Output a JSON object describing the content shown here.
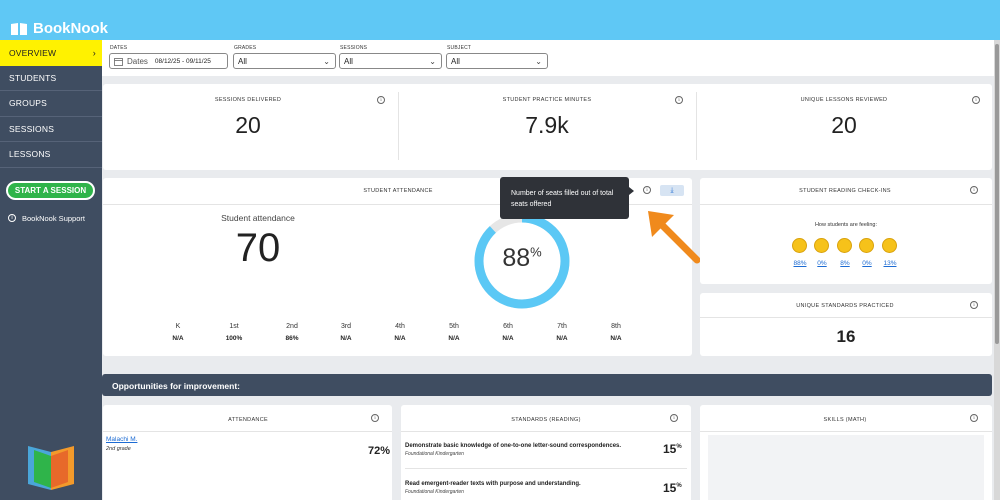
{
  "app": {
    "name": "BookNook"
  },
  "sidebar": {
    "items": [
      {
        "label": "OVERVIEW"
      },
      {
        "label": "STUDENTS"
      },
      {
        "label": "GROUPS"
      },
      {
        "label": "SESSIONS"
      },
      {
        "label": "LESSONS"
      }
    ],
    "start_label": "START A SESSION",
    "support_label": "BookNook Support"
  },
  "filters": {
    "dates_label": "DATES",
    "dates_placeholder": "Dates",
    "dates_value": "08/12/25 - 09/11/25",
    "grades_label": "GRADES",
    "grades_value": "All",
    "sessions_label": "SESSIONS",
    "sessions_value": "All",
    "subject_label": "SUBJECT",
    "subject_value": "All"
  },
  "stats": [
    {
      "title": "SESSIONS DELIVERED",
      "value": "20"
    },
    {
      "title": "STUDENT PRACTICE MINUTES",
      "value": "7.9k"
    },
    {
      "title": "UNIQUE LESSONS REVIEWED",
      "value": "20"
    }
  ],
  "attendance": {
    "title": "STUDENT ATTENDANCE",
    "label": "Student attendance",
    "value": "70",
    "percent": 0.88,
    "percent_num": "88",
    "percent_sign": "%",
    "tooltip": "Number of seats filled out of total seats offered",
    "grades": [
      {
        "grade": "K",
        "value": "N/A"
      },
      {
        "grade": "1st",
        "value": "100%"
      },
      {
        "grade": "2nd",
        "value": "86%"
      },
      {
        "grade": "3rd",
        "value": "N/A"
      },
      {
        "grade": "4th",
        "value": "N/A"
      },
      {
        "grade": "5th",
        "value": "N/A"
      },
      {
        "grade": "6th",
        "value": "N/A"
      },
      {
        "grade": "7th",
        "value": "N/A"
      },
      {
        "grade": "8th",
        "value": "N/A"
      }
    ]
  },
  "checkins": {
    "title": "STUDENT READING CHECK-INS",
    "subtitle": "How students are feeling:",
    "values": [
      "88%",
      "0%",
      "8%",
      "0%",
      "13%"
    ]
  },
  "standards": {
    "title": "UNIQUE STANDARDS PRACTICED",
    "value": "16"
  },
  "opportunities": {
    "title": "Opportunities for improvement:",
    "attendance_title": "ATTENDANCE",
    "student_name": "Malachi M.",
    "student_grade": "2nd grade",
    "student_pct": "72%",
    "standards_title": "STANDARDS (READING)",
    "std1_text": "Demonstrate basic knowledge of one-to-one letter-sound correspondences.",
    "std1_sub": "Foundational Kindergarten",
    "std1_pct": "15",
    "std2_text": "Read emergent-reader texts with purpose and understanding.",
    "std2_sub": "Foundational Kindergarten",
    "std2_pct": "15",
    "pct_sign": "%",
    "skills_title": "SKILLS (MATH)"
  },
  "colors": {
    "accent": "#5fc8f5",
    "sidebar": "#3f4d61",
    "active": "#fff200",
    "start": "#2fb44a",
    "ring": "#5bc8f5",
    "arrow": "#f08a1c"
  }
}
